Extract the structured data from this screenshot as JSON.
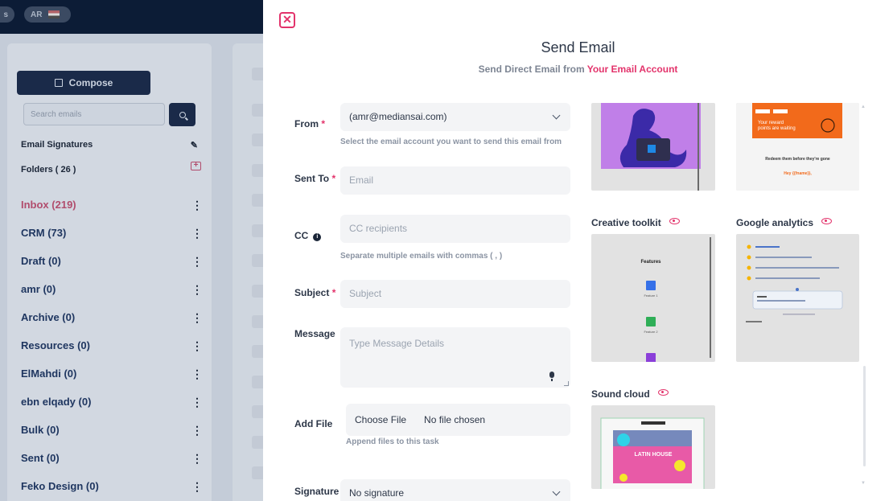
{
  "topbar": {
    "lang_partial": "s",
    "lang_label": "AR"
  },
  "sidebar": {
    "compose_label": "Compose",
    "search_placeholder": "Search emails",
    "signatures_label": "Email Signatures",
    "folders_label": "Folders ( 26 )",
    "folders": [
      {
        "label": "Inbox (219)"
      },
      {
        "label": "CRM (73)"
      },
      {
        "label": "Draft (0)"
      },
      {
        "label": "amr (0)"
      },
      {
        "label": "Archive (0)"
      },
      {
        "label": "Resources (0)"
      },
      {
        "label": "ElMahdi (0)"
      },
      {
        "label": "ebn elqady (0)"
      },
      {
        "label": "Bulk (0)"
      },
      {
        "label": "Sent (0)"
      },
      {
        "label": "Feko Design (0)"
      }
    ]
  },
  "modal": {
    "title": "Send Email",
    "subtitle_prefix": "Send Direct Email from ",
    "subtitle_accent": "Your Email Account",
    "accent_color": "#e3336b",
    "form": {
      "from_label": "From",
      "from_value": "(amr@mediansai.com)",
      "from_hint": "Select the email account you want to send this email from",
      "to_label": "Sent To",
      "to_placeholder": "Email",
      "cc_label": "CC",
      "cc_placeholder": "CC recipients",
      "cc_hint": "Separate multiple emails with commas ( , )",
      "subject_label": "Subject",
      "subject_placeholder": "Subject",
      "message_label": "Message",
      "message_placeholder": "Type Message Details",
      "file_label": "Add File",
      "file_button": "Choose File",
      "file_status": "No file chosen",
      "file_hint": "Append files to this task",
      "signature_label": "Signature",
      "signature_value": "No signature",
      "required_mark": "*"
    },
    "templates": [
      {
        "title": "Creative toolkit",
        "icon": "eye-icon",
        "heading": "Features",
        "items": [
          "Feature 1",
          "Feature 2"
        ]
      },
      {
        "title": "Google analytics",
        "icon": "eye-icon"
      },
      {
        "title": "Sound cloud",
        "icon": "eye-icon",
        "poster_text": "LATIN HOUSE"
      }
    ],
    "template_previews": {
      "reward_line1": "Your reward",
      "reward_line2": "points are waiting",
      "reward_cta": "Redeem them before they're gone",
      "reward_greeting": "Hey {{fname}},"
    }
  }
}
